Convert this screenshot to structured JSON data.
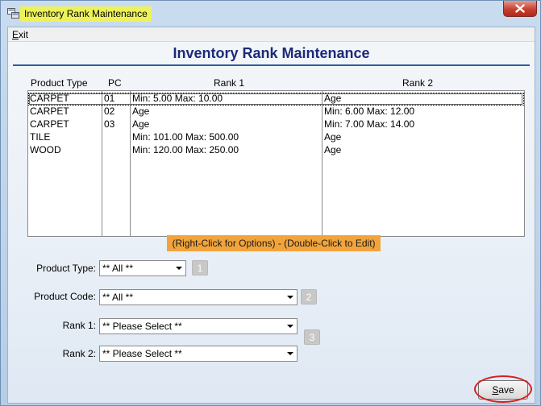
{
  "window": {
    "title": "Inventory Rank Maintenance"
  },
  "menu": {
    "exit_label": "Exit",
    "exit_first": "E",
    "exit_rest": "xit"
  },
  "page": {
    "heading": "Inventory Rank Maintenance",
    "hint": "(Right-Click for Options) - (Double-Click to Edit)"
  },
  "grid": {
    "columns": [
      "Product Type",
      "PC",
      "Rank 1",
      "Rank 2"
    ],
    "rows": [
      [
        "CARPET",
        "01",
        "Min: 5.00  Max: 10.00",
        "Age"
      ],
      [
        "CARPET",
        "02",
        "Age",
        "Min: 6.00  Max: 12.00"
      ],
      [
        "CARPET",
        "03",
        "Age",
        "Min: 7.00  Max: 14.00"
      ],
      [
        "TILE",
        "",
        "Min: 101.00  Max: 500.00",
        "Age"
      ],
      [
        "WOOD",
        "",
        "Min: 120.00  Max: 250.00",
        "Age"
      ]
    ],
    "selected_row": 0
  },
  "filters": {
    "product_type": {
      "label": "Product Type:",
      "value": "** All **",
      "step": "1"
    },
    "product_code": {
      "label": "Product Code:",
      "value": "** All **",
      "step": "2"
    },
    "rank1": {
      "label": "Rank 1:",
      "value": "** Please Select **"
    },
    "rank2": {
      "label": "Rank 2:",
      "value": "** Please Select **"
    },
    "rank_step": "3"
  },
  "actions": {
    "save_label": "Save",
    "save_first": "S",
    "save_rest": "ave"
  },
  "colors": {
    "heading": "#1b2a7a",
    "hint_bg": "#f2a43c",
    "title_highlight": "#eef25a",
    "annotation_ring": "#d62020"
  }
}
